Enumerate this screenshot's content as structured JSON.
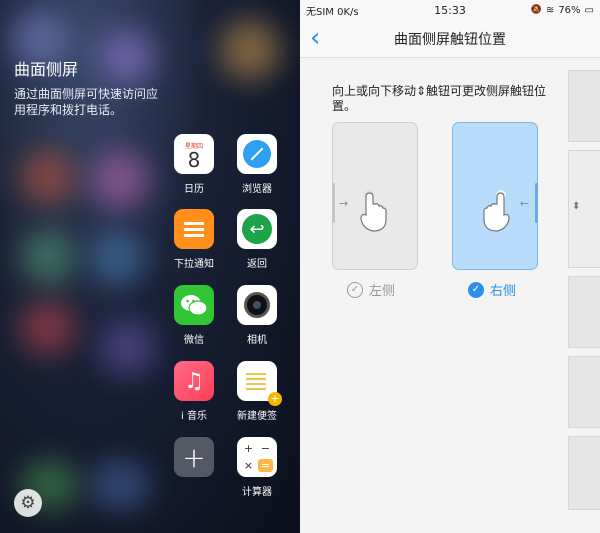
{
  "left_panel": {
    "title": "曲面侧屏",
    "description": "通过曲面侧屏可快速访问应用程序和拨打电话。",
    "apps": [
      {
        "label": "日历",
        "icon": "calendar-icon",
        "cal_header": "星期四",
        "cal_day": "8"
      },
      {
        "label": "浏览器",
        "icon": "browser-icon"
      },
      {
        "label": "下拉通知",
        "icon": "notification-icon"
      },
      {
        "label": "返回",
        "icon": "back-arrow-icon",
        "glyph": "↩"
      },
      {
        "label": "微信",
        "icon": "wechat-icon"
      },
      {
        "label": "相机",
        "icon": "camera-icon"
      },
      {
        "label": "i 音乐",
        "icon": "music-icon",
        "glyph": "♫"
      },
      {
        "label": "新建便签",
        "icon": "note-icon",
        "badge": "+"
      },
      {
        "label": "",
        "icon": "add-icon",
        "glyph": "+"
      },
      {
        "label": "计算器",
        "icon": "calculator-icon",
        "keys": [
          "+",
          "−",
          "×",
          "="
        ]
      }
    ],
    "settings_glyph": "⚙"
  },
  "right_panel": {
    "status": {
      "carrier": "无SIM 0K/s",
      "time": "15:33",
      "mute_glyph": "🔕",
      "wifi_glyph": "≋",
      "battery": "76%",
      "battery_glyph": "▭"
    },
    "nav": {
      "back_glyph": "‹",
      "title": "曲面侧屏触钮位置"
    },
    "instruction": "向上或向下移动⇕触钮可更改侧屏触钮位置。",
    "options": [
      {
        "label": "左侧",
        "selected": false,
        "check": "✓"
      },
      {
        "label": "右侧",
        "selected": true,
        "check": "✓"
      }
    ],
    "arrow_right": "→",
    "arrow_left": "←",
    "side_handle_glyph": "⬍"
  },
  "colors": {
    "accent": "#2f8ee5",
    "wechat": "#32c534",
    "notify": "#ff8f1a"
  }
}
